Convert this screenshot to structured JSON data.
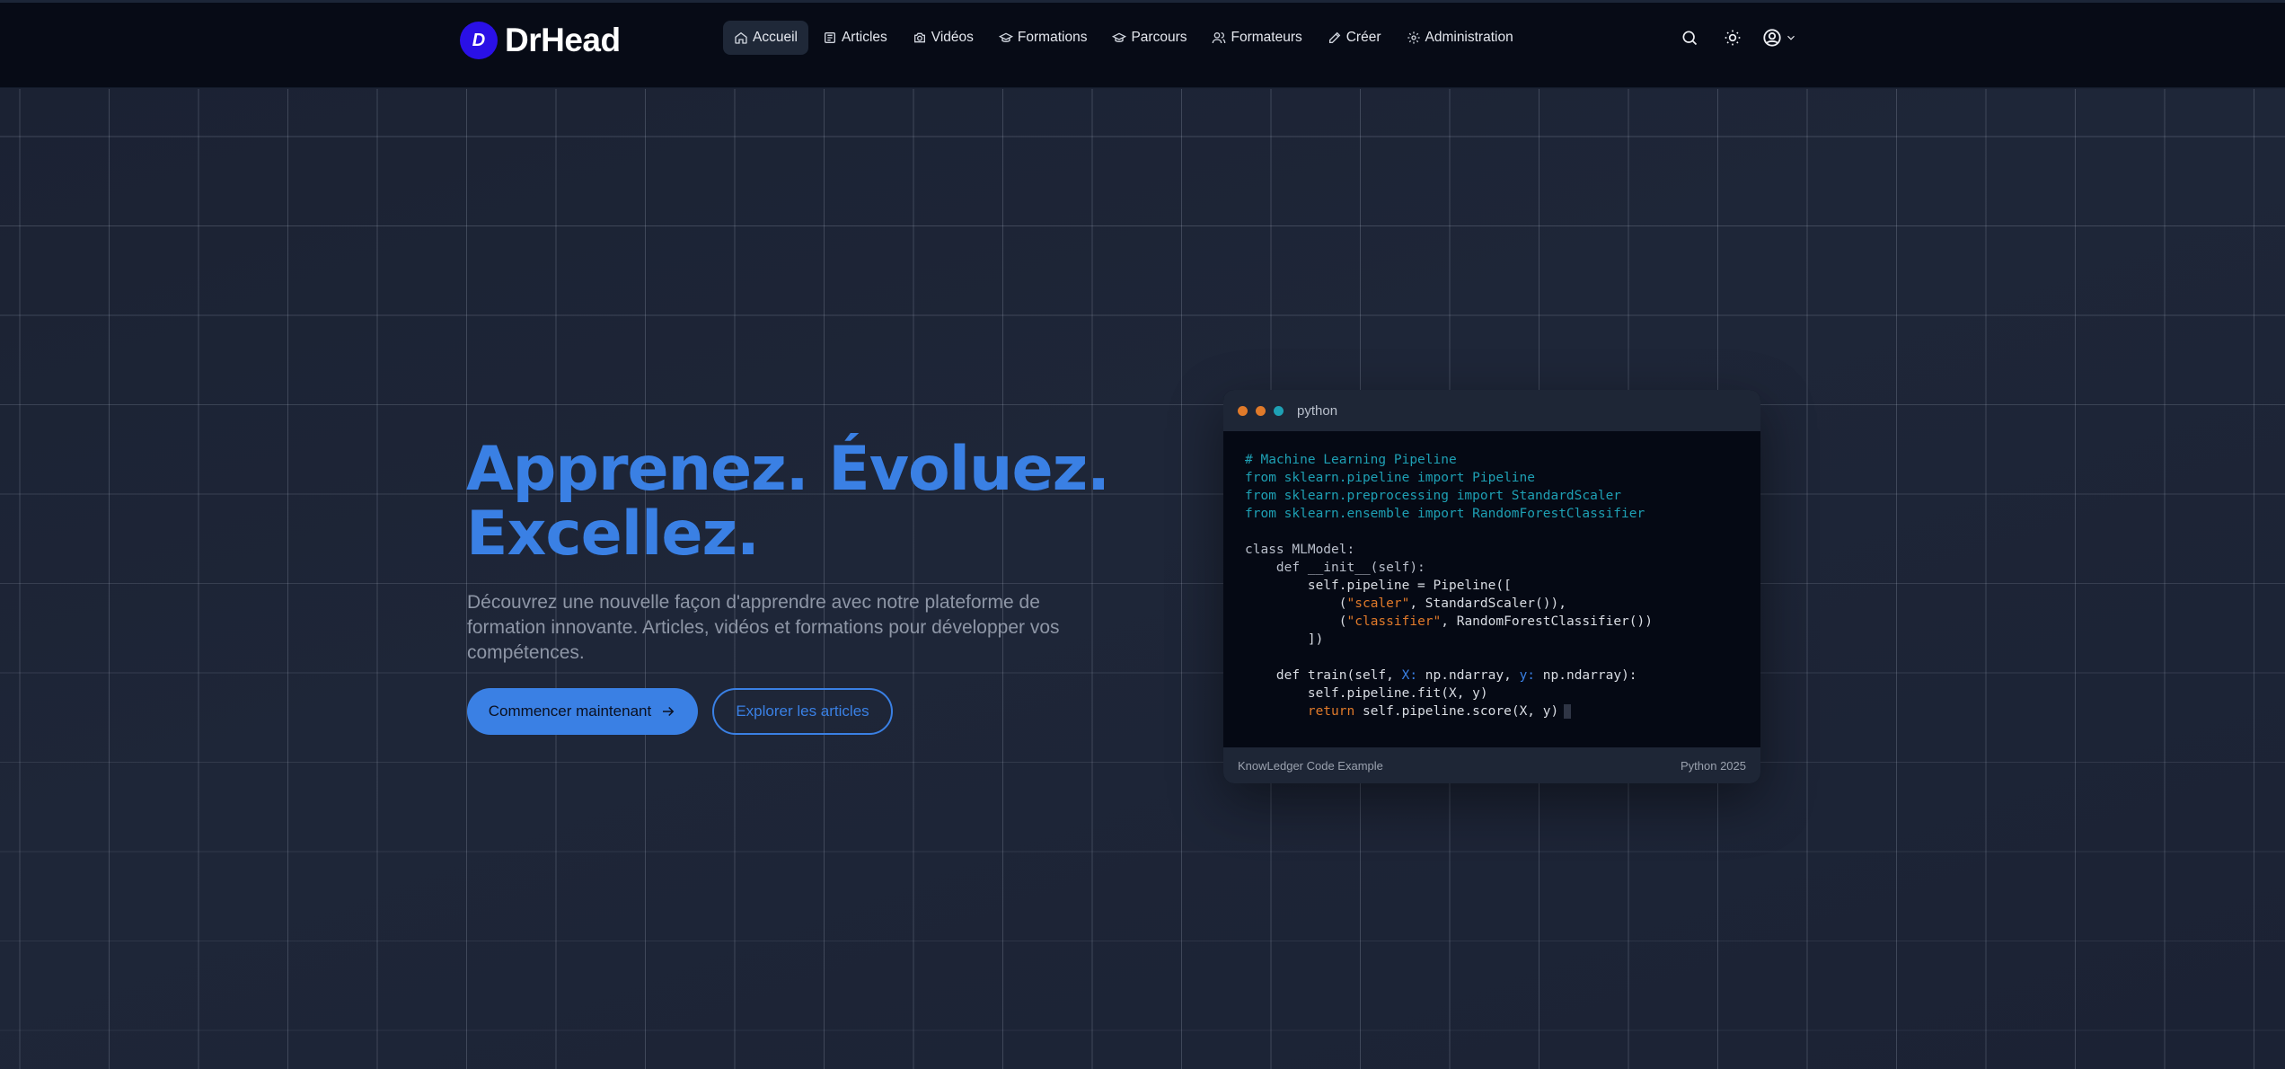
{
  "brand": {
    "name": "DrHead",
    "badge_letter": "D",
    "badge_color": "#2a10e6"
  },
  "nav": {
    "items": [
      {
        "label": "Accueil",
        "icon": "home-icon",
        "active": true
      },
      {
        "label": "Articles",
        "icon": "newspaper-icon"
      },
      {
        "label": "Vidéos",
        "icon": "camera-icon"
      },
      {
        "label": "Formations",
        "icon": "graduation-cap-icon"
      },
      {
        "label": "Parcours",
        "icon": "graduation-cap-icon"
      },
      {
        "label": "Formateurs",
        "icon": "users-icon"
      },
      {
        "label": "Créer",
        "icon": "edit-icon"
      },
      {
        "label": "Administration",
        "icon": "gear-icon"
      }
    ],
    "right_icons": [
      "search-icon",
      "sun-icon",
      "user-circle-icon",
      "chevron-down-icon"
    ]
  },
  "hero": {
    "headline_line1": "Apprenez. Évoluez.",
    "headline_line2": "Excellez.",
    "subtitle": "Découvrez une nouvelle façon d'apprendre avec notre plateforme de formation innovante. Articles, vidéos et formations pour développer vos compétences.",
    "primary_button": "Commencer maintenant",
    "secondary_button": "Explorer les articles",
    "accent_color": "#3a80e4"
  },
  "code_card": {
    "language": "python",
    "dot_colors": [
      "#e07a2a",
      "#e07a2a",
      "#1ea0b4"
    ],
    "lines": [
      "# Machine Learning Pipeline",
      "from sklearn.pipeline import Pipeline",
      "from sklearn.preprocessing import StandardScaler",
      "from sklearn.ensemble import RandomForestClassifier",
      "",
      "class MLModel:",
      "    def __init__(self):",
      "        self.pipeline = Pipeline([",
      "            (\"scaler\", StandardScaler()),",
      "            (\"classifier\", RandomForestClassifier())",
      "        ])",
      "",
      "    def train(self, X: np.ndarray, y: np.ndarray):",
      "        self.pipeline.fit(X, y)",
      "        return self.pipeline.score(X, y)"
    ],
    "footer_left": "KnowLedger Code Example",
    "footer_right": "Python 2025"
  }
}
